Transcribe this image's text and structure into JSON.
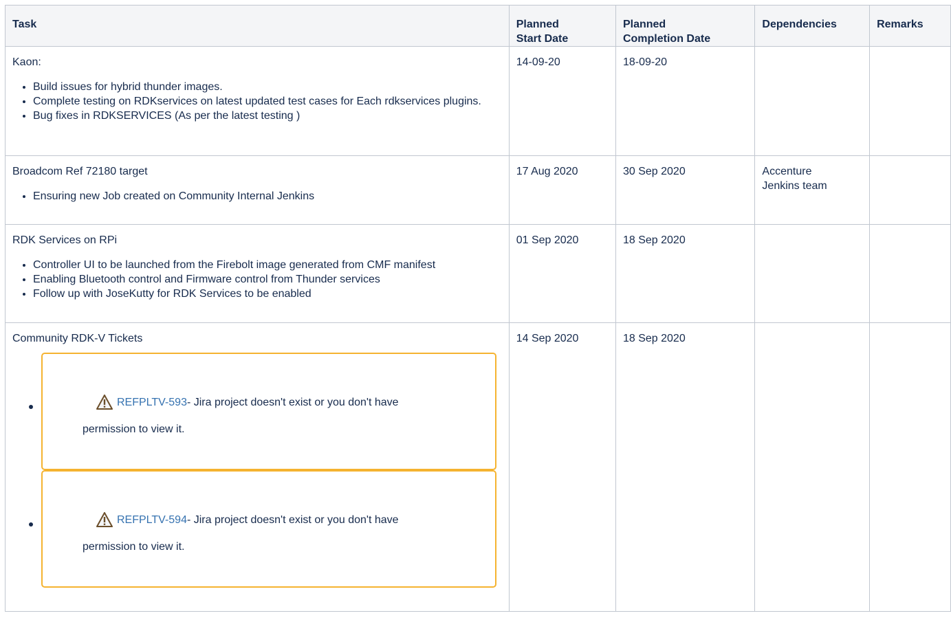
{
  "headers": {
    "task": "Task",
    "start": "Planned\nStart Date",
    "completion": "Planned\nCompletion Date",
    "dependencies": "Dependencies",
    "remarks": "Remarks"
  },
  "rows": [
    {
      "task_title": "Kaon:",
      "bullets": [
        "Build issues for  hybrid thunder images.",
        "Complete testing on RDKservices on latest updated test cases for Each rdkservices plugins.",
        "Bug fixes in RDKSERVICES  (As per the latest testing )"
      ],
      "start": "14-09-20",
      "completion": "18-09-20",
      "dependencies": "",
      "remarks": ""
    },
    {
      "task_title": "Broadcom Ref 72180 target",
      "bullets": [
        "Ensuring new Job created on Community Internal Jenkins"
      ],
      "start": "17 Aug 2020",
      "completion": "30 Sep 2020",
      "dependencies": "Accenture Jenkins team",
      "remarks": ""
    },
    {
      "task_title": "RDK Services on RPi",
      "bullets": [
        "Controller UI to be launched from the Firebolt image generated from CMF manifest",
        "Enabling Bluetooth control and Firmware control from Thunder services",
        "Follow up with JoseKutty for RDK Services to be enabled"
      ],
      "start": "01 Sep 2020",
      "completion": "18 Sep 2020",
      "dependencies": "",
      "remarks": ""
    },
    {
      "task_title": "Community RDK-V Tickets",
      "jira": [
        {
          "key": "REFPLTV-593",
          "message": " - Jira project doesn't exist or you don't have",
          "message2": "permission to view it."
        },
        {
          "key": "REFPLTV-594",
          "message": " - Jira project doesn't exist or you don't have",
          "message2": "permission to view it."
        }
      ],
      "start": "14 Sep 2020",
      "completion": "18 Sep 2020",
      "dependencies": "",
      "remarks": ""
    }
  ],
  "colors": {
    "warning_border": "#f5b330",
    "link": "#3572b0",
    "grid": "#c1c7d0",
    "header_bg": "#f4f5f7"
  },
  "icons": {
    "jira_warning": "warning-triangle-icon"
  }
}
